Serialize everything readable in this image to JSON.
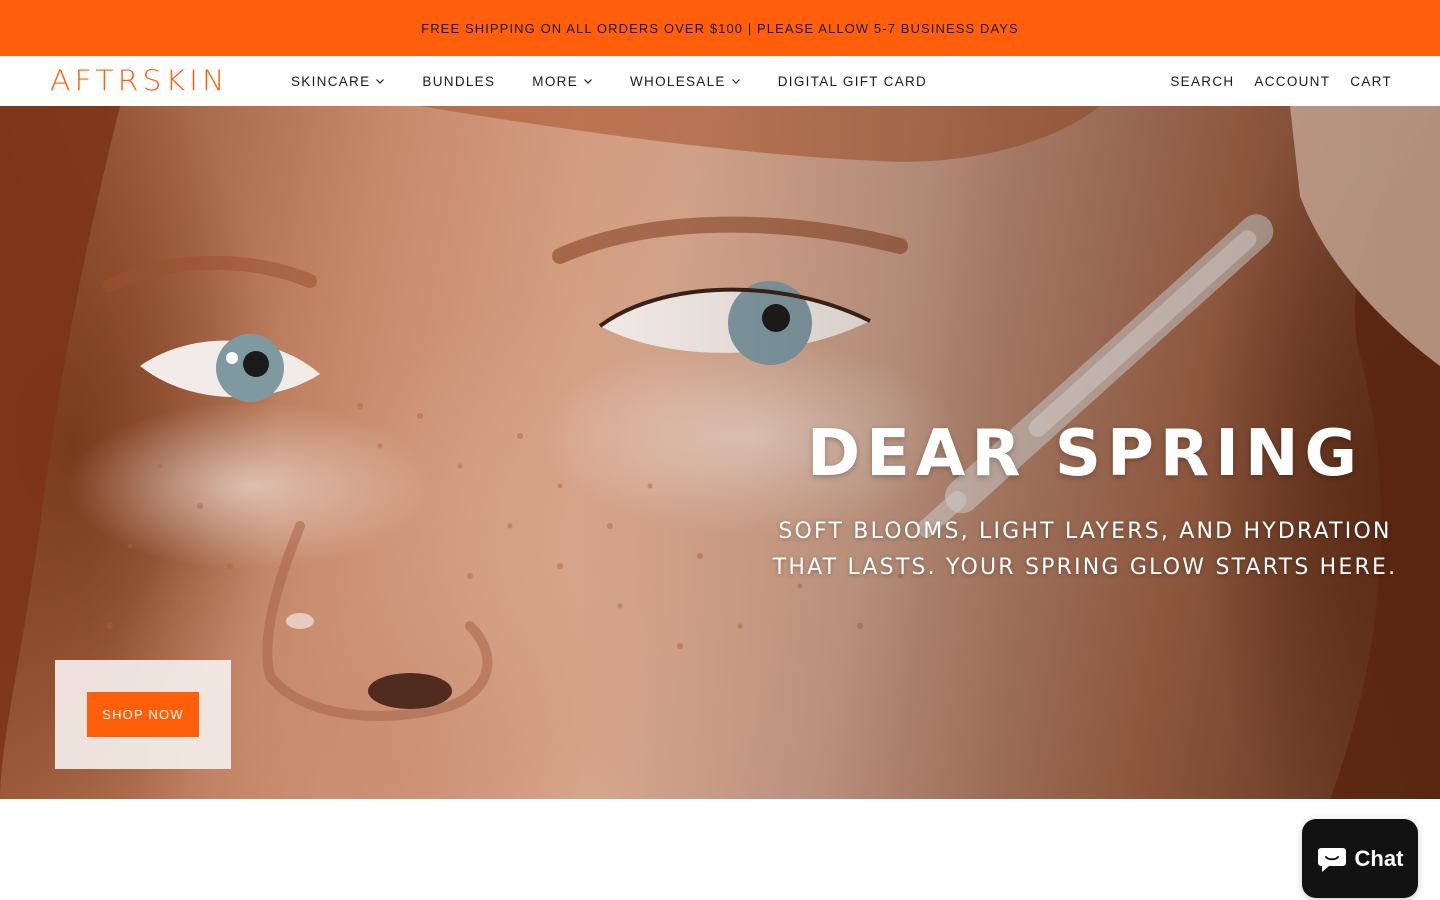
{
  "announcement": {
    "text": "FREE SHIPPING ON ALL ORDERS OVER $100 | PLEASE ALLOW 5-7 BUSINESS DAYS"
  },
  "header": {
    "logo_text": "AFTRSKIN",
    "nav": [
      {
        "label": "SKINCARE",
        "has_dropdown": true
      },
      {
        "label": "BUNDLES",
        "has_dropdown": false
      },
      {
        "label": "MORE",
        "has_dropdown": true
      },
      {
        "label": "WHOLESALE",
        "has_dropdown": true
      },
      {
        "label": "DIGITAL GIFT CARD",
        "has_dropdown": false
      }
    ],
    "utility": {
      "search": "SEARCH",
      "account": "ACCOUNT",
      "cart": "CART"
    }
  },
  "hero": {
    "title": "DEAR SPRING",
    "subtitle": "SOFT BLOOMS, LIGHT LAYERS, AND HYDRATION THAT LASTS. YOUR SPRING GLOW STARTS HERE.",
    "cta_label": "SHOP NOW",
    "image_description_icon": "face-with-dropper-photo"
  },
  "chat_widget": {
    "label": "Chat",
    "icon": "chat-bubble-icon"
  },
  "colors": {
    "brand_orange": "#ff5f0a",
    "chat_bg": "#121212",
    "header_bg": "#ffffff"
  }
}
